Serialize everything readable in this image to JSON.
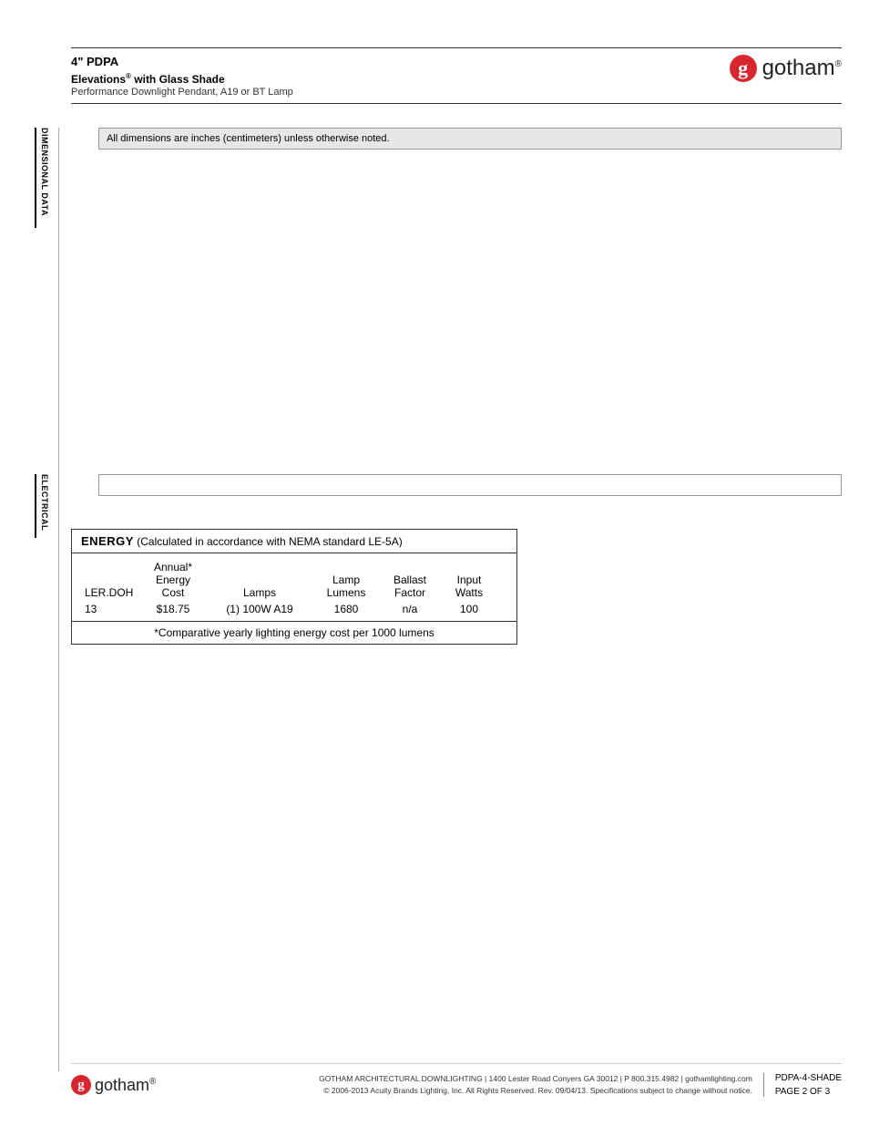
{
  "header": {
    "title": "4\" PDPA",
    "subtitle_prefix": "Elevations",
    "subtitle_reg": "®",
    "subtitle_suffix": " with Glass Shade",
    "desc": "Performance Downlight Pendant, A19 or BT Lamp"
  },
  "brand": {
    "mark": "g",
    "name": "gotham",
    "reg": "®"
  },
  "tabs": {
    "dimensional": "DIMENSIONAL DATA",
    "electrical": "ELECTRICAL"
  },
  "dim_note": "All dimensions are inches (centimeters) unless otherwise noted.",
  "energy": {
    "title_bold": "ENERGY",
    "title_rest": " (Calculated in accordance with NEMA standard  LE-5A)",
    "cols": {
      "c1": "LER.DOH",
      "c2a": "Annual*",
      "c2b": "Energy",
      "c2c": "Cost",
      "c3": "Lamps",
      "c4a": "Lamp",
      "c4b": "Lumens",
      "c5a": "Ballast",
      "c5b": "Factor",
      "c6a": "Input",
      "c6b": "Watts"
    },
    "row": {
      "ler": "13",
      "cost": "$18.75",
      "lamps": "(1) 100W A19",
      "lumens": "1680",
      "ballast": "n/a",
      "watts": "100"
    },
    "footnote": "*Comparative yearly lighting energy cost per 1000 lumens"
  },
  "footer": {
    "line1": "GOTHAM ARCHITECTURAL DOWNLIGHTING  |  1400 Lester Road Conyers GA 30012  |  P 800.315.4982  |  gothamlighting.com",
    "line2": "© 2006-2013 Acuity Brands Lighting, Inc. All Rights Reserved. Rev. 09/04/13. Specifications subject to change without notice.",
    "doc": "PDPA-4-SHADE",
    "page": "PAGE 2 OF 3"
  }
}
